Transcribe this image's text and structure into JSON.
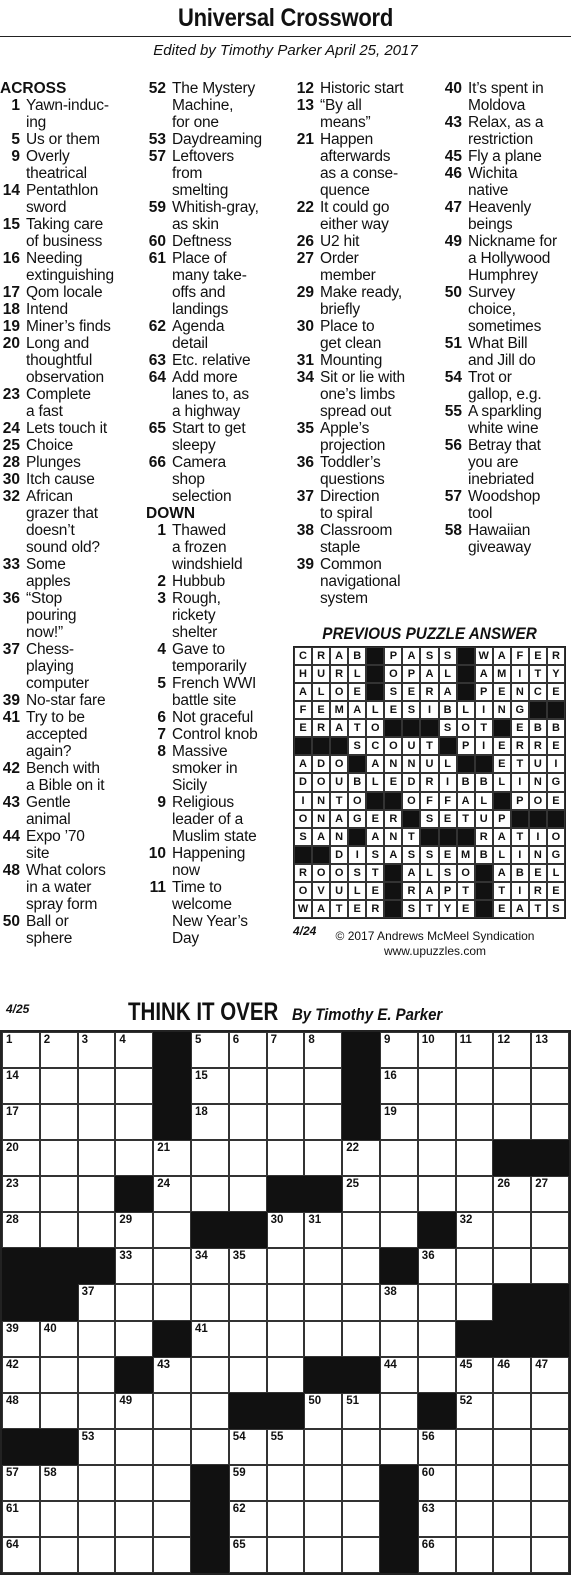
{
  "header": {
    "title": "Universal Crossword",
    "editor": "Edited by Timothy Parker April 25, 2017"
  },
  "clue_columns": [
    [
      {
        "h": "ACROSS"
      },
      {
        "n": "1",
        "t": "Yawn-induc-\ning"
      },
      {
        "n": "5",
        "t": "Us or them"
      },
      {
        "n": "9",
        "t": "Overly\ntheatrical"
      },
      {
        "n": "14",
        "t": "Pentathlon\nsword"
      },
      {
        "n": "15",
        "t": "Taking care\nof business"
      },
      {
        "n": "16",
        "t": "Needing\nextinguishing"
      },
      {
        "n": "17",
        "t": "Qom locale"
      },
      {
        "n": "18",
        "t": "Intend"
      },
      {
        "n": "19",
        "t": "Miner’s finds"
      },
      {
        "n": "20",
        "t": "Long and\nthoughtful\nobservation"
      },
      {
        "n": "23",
        "t": "Complete\na fast"
      },
      {
        "n": "24",
        "t": "Lets touch it"
      },
      {
        "n": "25",
        "t": "Choice"
      },
      {
        "n": "28",
        "t": "Plunges"
      },
      {
        "n": "30",
        "t": "Itch cause"
      },
      {
        "n": "32",
        "t": "African\ngrazer that\ndoesn’t\nsound old?"
      },
      {
        "n": "33",
        "t": "Some\napples"
      },
      {
        "n": "36",
        "t": "“Stop\npouring\nnow!”"
      },
      {
        "n": "37",
        "t": "Chess-\nplaying\ncomputer"
      },
      {
        "n": "39",
        "t": "No-star fare"
      },
      {
        "n": "41",
        "t": "Try to be\naccepted\nagain?"
      },
      {
        "n": "42",
        "t": "Bench with\na Bible on it"
      },
      {
        "n": "43",
        "t": "Gentle\nanimal"
      },
      {
        "n": "44",
        "t": "Expo ’70\nsite"
      },
      {
        "n": "48",
        "t": "What colors\nin a water\nspray form"
      },
      {
        "n": "50",
        "t": "Ball or\nsphere"
      }
    ],
    [
      {
        "n": "52",
        "t": "The Mystery\nMachine,\nfor one"
      },
      {
        "n": "53",
        "t": "Daydreaming"
      },
      {
        "n": "57",
        "t": "Leftovers\nfrom\nsmelting"
      },
      {
        "n": "59",
        "t": "Whitish-gray,\nas skin"
      },
      {
        "n": "60",
        "t": "Deftness"
      },
      {
        "n": "61",
        "t": "Place of\nmany take-\noffs and\nlandings"
      },
      {
        "n": "62",
        "t": "Agenda\ndetail"
      },
      {
        "n": "63",
        "t": "Etc. relative"
      },
      {
        "n": "64",
        "t": "Add more\nlanes to, as\na highway"
      },
      {
        "n": "65",
        "t": "Start to get\nsleepy"
      },
      {
        "n": "66",
        "t": "Camera\nshop\nselection"
      },
      {
        "h": "DOWN"
      },
      {
        "n": "1",
        "t": "Thawed\na frozen\nwindshield"
      },
      {
        "n": "2",
        "t": "Hubbub"
      },
      {
        "n": "3",
        "t": "Rough,\nrickety\nshelter"
      },
      {
        "n": "4",
        "t": "Gave to\ntemporarily"
      },
      {
        "n": "5",
        "t": "French WWI\nbattle site"
      },
      {
        "n": "6",
        "t": "Not graceful"
      },
      {
        "n": "7",
        "t": "Control knob"
      },
      {
        "n": "8",
        "t": "Massive\nsmoker in\nSicily"
      },
      {
        "n": "9",
        "t": "Religious\nleader of a\nMuslim state"
      },
      {
        "n": "10",
        "t": "Happening\nnow"
      },
      {
        "n": "11",
        "t": "Time to\nwelcome\nNew Year’s\nDay"
      }
    ],
    [
      {
        "n": "12",
        "t": "Historic start"
      },
      {
        "n": "13",
        "t": "“By all\nmeans”"
      },
      {
        "n": "21",
        "t": "Happen\nafterwards\nas a conse-\nquence"
      },
      {
        "n": "22",
        "t": "It could go\neither way"
      },
      {
        "n": "26",
        "t": "U2 hit"
      },
      {
        "n": "27",
        "t": "Order\nmember"
      },
      {
        "n": "29",
        "t": "Make ready,\nbriefly"
      },
      {
        "n": "30",
        "t": "Place to\nget clean"
      },
      {
        "n": "31",
        "t": "Mounting"
      },
      {
        "n": "34",
        "t": "Sit or lie with\none’s limbs\nspread out"
      },
      {
        "n": "35",
        "t": "Apple’s\nprojection"
      },
      {
        "n": "36",
        "t": "Toddler’s\nquestions"
      },
      {
        "n": "37",
        "t": "Direction\nto spiral"
      },
      {
        "n": "38",
        "t": "Classroom\nstaple"
      },
      {
        "n": "39",
        "t": "Common\nnavigational\nsystem"
      }
    ],
    [
      {
        "n": "40",
        "t": "It’s spent in\nMoldova"
      },
      {
        "n": "43",
        "t": "Relax, as a\nrestriction"
      },
      {
        "n": "45",
        "t": "Fly a plane"
      },
      {
        "n": "46",
        "t": "Wichita\nnative"
      },
      {
        "n": "47",
        "t": "Heavenly\nbeings"
      },
      {
        "n": "49",
        "t": "Nickname for\na Hollywood\nHumphrey"
      },
      {
        "n": "50",
        "t": "Survey\nchoice,\nsometimes"
      },
      {
        "n": "51",
        "t": "What Bill\nand Jill do"
      },
      {
        "n": "54",
        "t": "Trot or\ngallop, e.g."
      },
      {
        "n": "55",
        "t": "A sparkling\nwhite wine"
      },
      {
        "n": "56",
        "t": "Betray that\nyou are\ninebriated"
      },
      {
        "n": "57",
        "t": "Woodshop\ntool"
      },
      {
        "n": "58",
        "t": "Hawaiian\ngiveaway"
      }
    ]
  ],
  "previous": {
    "title": "PREVIOUS PUZZLE ANSWER",
    "date": "4/24",
    "copyright": "© 2017 Andrews McMeel Syndication",
    "url": "www.upuzzles.com",
    "rows": [
      "CRAB#PASS#WAFER",
      "HURL#OPAL#AMITY",
      "ALOE#SERA#PENCE",
      "FEMALESIBLING##",
      "ERATO###SOT#EBB",
      "###SCOUT#PIERRE",
      "ADO#ANNUL##ETUI",
      "DOUBLEDRIBBLING",
      "INTO##OFFAL#POE",
      "ONAGER#SETUP###",
      "SAN#ANT###RATIO",
      "##DISASSEMBLING",
      "ROOST#ALSO#ABEL",
      "OVULE#RAPT#TIRE",
      "WATER#STYE#EATS"
    ]
  },
  "puzzle": {
    "date": "4/25",
    "title": "THINK IT OVER",
    "byline": "By Timothy E. Parker",
    "rows": [
      "....#....#.....",
      "....#....#.....",
      "....#....#.....",
      ".............##",
      "...#...##......",
      ".....##....#...",
      "###.......#....",
      "##...........##",
      "....#.......###",
      "...#....##.....",
      "......##...#...",
      "##.............",
      ".....#....#....",
      ".....#....#....",
      ".....#....#...."
    ]
  }
}
